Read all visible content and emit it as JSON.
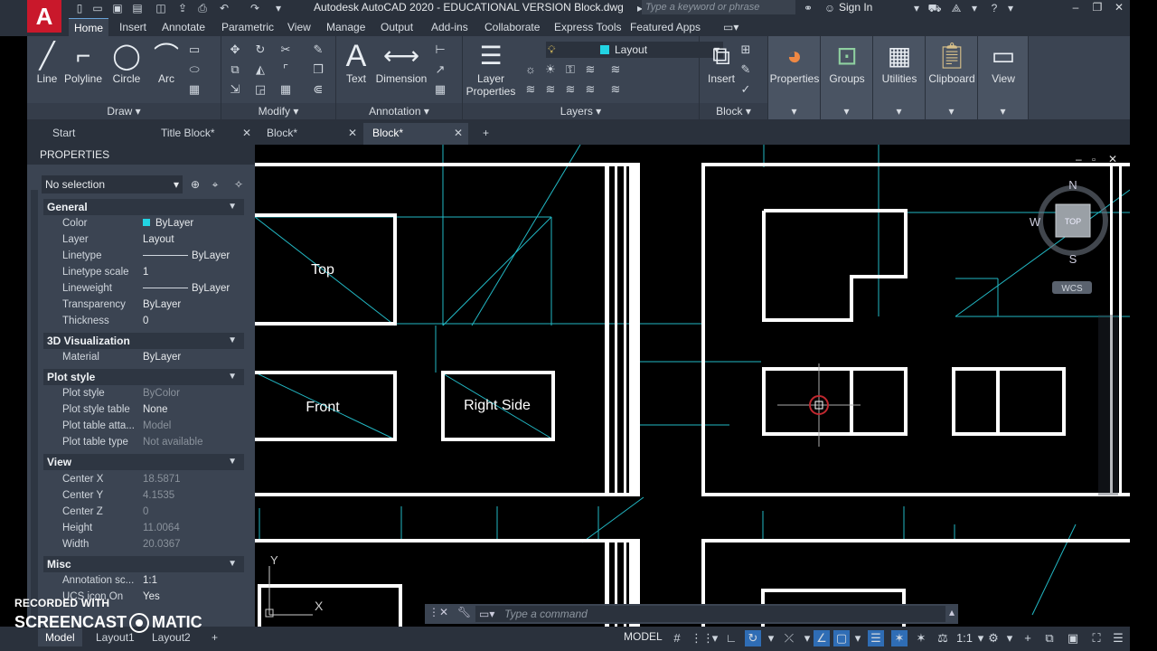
{
  "titlebar": {
    "app_logo": "A",
    "title": "Autodesk AutoCAD 2020 - EDUCATIONAL VERSION   Block.dwg",
    "search_placeholder": "Type a keyword or phrase",
    "signin": "Sign In"
  },
  "menu_tabs": [
    "Home",
    "Insert",
    "Annotate",
    "Parametric",
    "View",
    "Manage",
    "Output",
    "Add-ins",
    "Collaborate",
    "Express Tools",
    "Featured Apps"
  ],
  "ribbon": {
    "draw": {
      "title": "Draw",
      "tools": [
        "Line",
        "Polyline",
        "Circle",
        "Arc"
      ]
    },
    "modify": {
      "title": "Modify"
    },
    "annotation": {
      "title": "Annotation",
      "tools": [
        "Text",
        "Dimension"
      ]
    },
    "layers": {
      "title": "Layers",
      "tool": "Layer Properties",
      "current_layer": "Layout"
    },
    "block": {
      "title": "Block",
      "tool": "Insert"
    },
    "properties": "Properties",
    "groups": "Groups",
    "utilities": "Utilities",
    "clipboard": "Clipboard",
    "view": "View"
  },
  "doc_tabs": [
    "Start",
    "Title Block*",
    "Block*",
    "Block*"
  ],
  "properties": {
    "header": "PROPERTIES",
    "selection": "No selection",
    "general": {
      "title": "General",
      "color": "ByLayer",
      "layer": "Layout",
      "linetype": "ByLayer",
      "linetype_scale": "1",
      "lineweight": "ByLayer",
      "transparency": "ByLayer",
      "thickness": "0"
    },
    "labels": {
      "color": "Color",
      "layer": "Layer",
      "linetype": "Linetype",
      "linetype_scale": "Linetype scale",
      "lineweight": "Lineweight",
      "transparency": "Transparency",
      "thickness": "Thickness",
      "material": "Material",
      "plot_style": "Plot style",
      "plot_style_table": "Plot style table",
      "plot_table_attach": "Plot table atta...",
      "plot_table_type": "Plot table type",
      "center_x": "Center X",
      "center_y": "Center Y",
      "center_z": "Center Z",
      "height": "Height",
      "width": "Width",
      "annotation_scale": "Annotation sc...",
      "ucs_icon_on": "UCS icon On"
    },
    "viz": {
      "title": "3D Visualization",
      "material": "ByLayer"
    },
    "plot": {
      "title": "Plot style",
      "plot_style": "ByColor",
      "plot_style_table": "None",
      "plot_table_attach": "Model",
      "plot_table_type": "Not available"
    },
    "view": {
      "title": "View",
      "center_x": "18.5871",
      "center_y": "4.1535",
      "center_z": "0",
      "height": "11.0064",
      "width": "20.0367"
    },
    "misc": {
      "title": "Misc",
      "annotation_scale": "1:1",
      "ucs_icon_on": "Yes"
    }
  },
  "canvas": {
    "labels": {
      "top": "Top",
      "front": "Front",
      "right_side": "Right Side"
    },
    "viewcube": {
      "n": "N",
      "s": "S",
      "w": "W",
      "face": "TOP",
      "wcs": "WCS"
    },
    "ucs": {
      "y": "Y",
      "x": "X"
    }
  },
  "command": {
    "placeholder": "Type a command"
  },
  "statusbar": {
    "layout_tabs": [
      "Model",
      "Layout1",
      "Layout2"
    ],
    "model": "MODEL",
    "scale": "1:1"
  },
  "watermark": {
    "line1": "RECORDED WITH",
    "left": "SCREENCAST",
    "right": "MATIC"
  },
  "colors": {
    "accent": "#6aa3d8",
    "cyan": "#22d4e3",
    "logo": "#c9182b",
    "panel": "#3b4452"
  }
}
